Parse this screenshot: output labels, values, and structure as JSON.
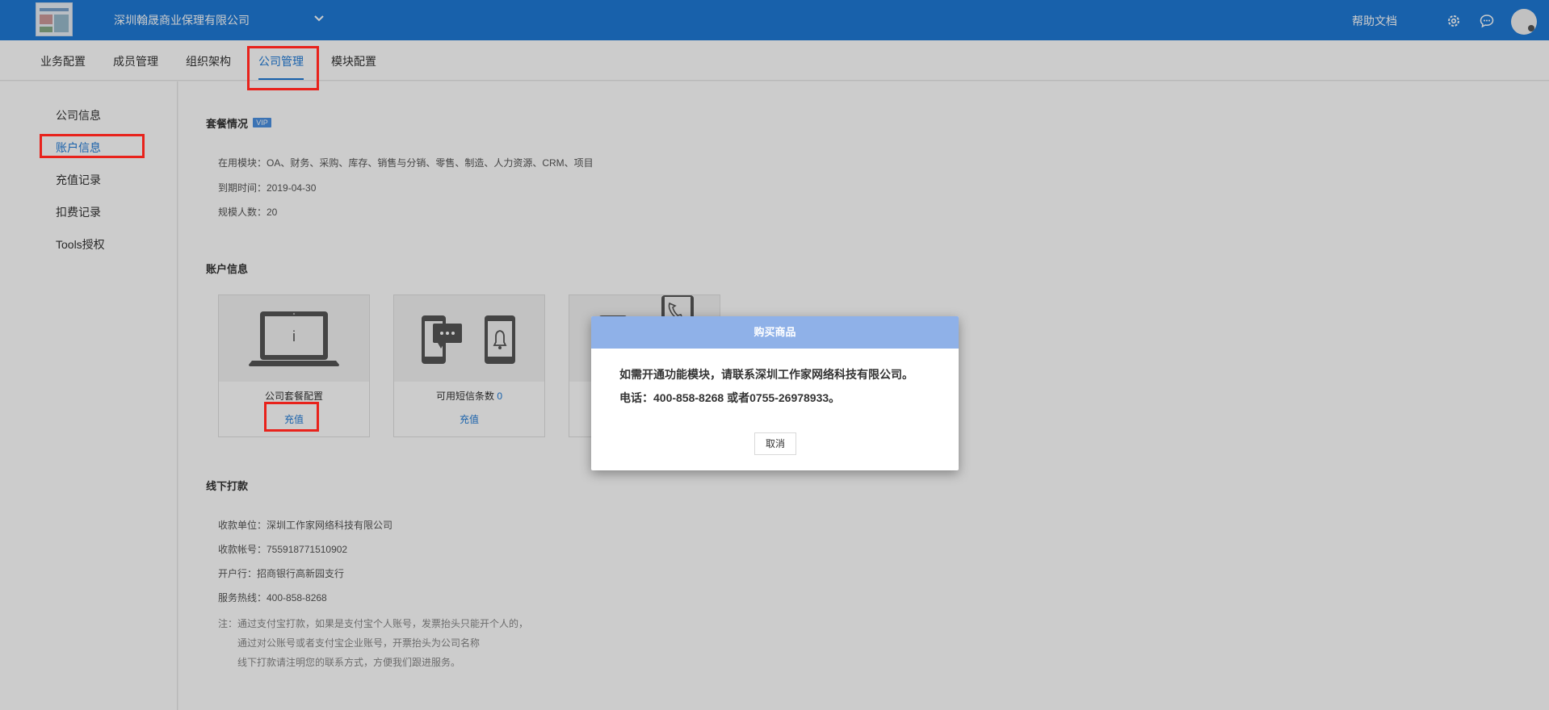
{
  "header": {
    "company_name": "深圳翰晟商业保理有限公司",
    "help_label": "帮助文档",
    "brand_color": "#1f7ad6"
  },
  "tabs": [
    {
      "label": "业务配置"
    },
    {
      "label": "成员管理"
    },
    {
      "label": "组织架构"
    },
    {
      "label": "公司管理",
      "active": true
    },
    {
      "label": "模块配置"
    }
  ],
  "sidebar": {
    "items": [
      {
        "label": "公司信息"
      },
      {
        "label": "账户信息",
        "active": true
      },
      {
        "label": "充值记录"
      },
      {
        "label": "扣费记录"
      },
      {
        "label": "Tools授权"
      }
    ]
  },
  "plan": {
    "title": "套餐情况",
    "badge": "VIP",
    "modules": "在用模块：OA、财务、采购、库存、销售与分销、零售、制造、人力资源、CRM、项目",
    "expiry": "到期时间：2019-04-30",
    "seats": "规模人数：20"
  },
  "account": {
    "title": "账户信息",
    "cards": [
      {
        "label": "公司套餐配置",
        "link": "充值",
        "icon": "laptop-info-icon"
      },
      {
        "label": "可用短信条数",
        "count": "0",
        "link": "充值",
        "icon": "phone-sms-icon"
      },
      {
        "icon": "phone-call-icon"
      }
    ]
  },
  "offline": {
    "title": "线下打款",
    "payee": "收款单位：深圳工作家网络科技有限公司",
    "account_no": "收款帐号：755918771510902",
    "bank": "开户行：招商银行高新园支行",
    "hotline": "服务热线：400-858-8268",
    "note_lines": [
      "注：通过支付宝打款，如果是支付宝个人账号，发票抬头只能开个人的，",
      "通过对公账号或者支付宝企业账号，开票抬头为公司名称",
      "线下打款请注明您的联系方式，方便我们跟进服务。"
    ]
  },
  "modal": {
    "title": "购买商品",
    "line1": "如需开通功能模块，请联系深圳工作家网络科技有限公司。",
    "line2": "电话：400-858-8268 或者0755-26978933。",
    "cancel_label": "取消"
  }
}
